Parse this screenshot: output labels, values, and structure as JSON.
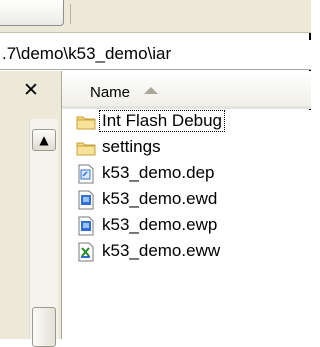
{
  "address": {
    "path": ".7\\demo\\k53_demo\\iar"
  },
  "sidebar": {
    "close_glyph": "✕",
    "scroll_up_glyph": "▲"
  },
  "header": {
    "name_label": "Name",
    "sort": "ascending"
  },
  "files": [
    {
      "name": "Int Flash Debug",
      "type": "folder-icon",
      "focused": true
    },
    {
      "name": "settings",
      "type": "folder-icon",
      "focused": false
    },
    {
      "name": "k53_demo.dep",
      "type": "dep-file-icon",
      "focused": false
    },
    {
      "name": "k53_demo.ewd",
      "type": "ewd-file-icon",
      "focused": false
    },
    {
      "name": "k53_demo.ewp",
      "type": "ewp-file-icon",
      "focused": false
    },
    {
      "name": "k53_demo.eww",
      "type": "eww-file-icon",
      "focused": false
    }
  ],
  "colors": {
    "folder": "#f2d77a",
    "folder_edge": "#c9a23a",
    "file_blue": "#2e6fd6",
    "window_bg": "#ece9d8"
  }
}
